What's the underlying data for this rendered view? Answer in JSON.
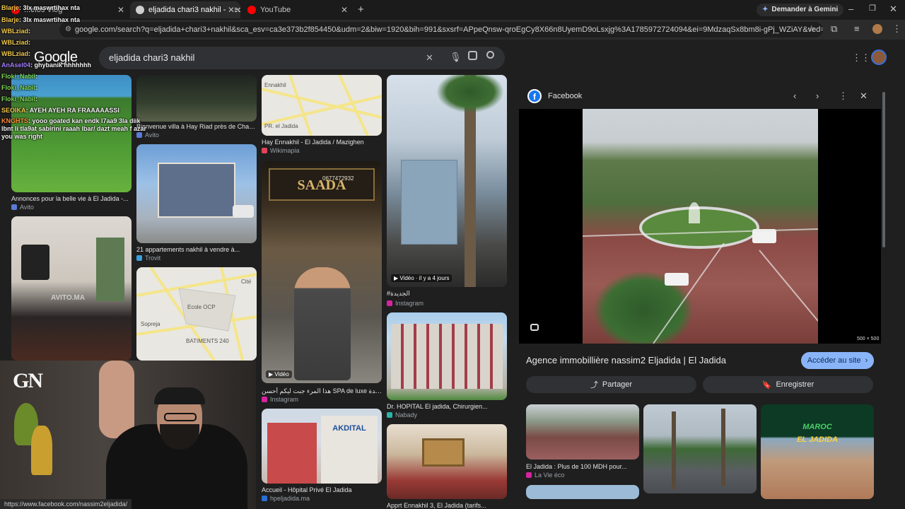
{
  "browser": {
    "tabs": [
      {
        "label": "...elos Vlog",
        "favicon_color": "#ff0000"
      },
      {
        "label": "eljadida chari3 nakhil - Recherc",
        "favicon_color": "#cfcfcf"
      },
      {
        "label": "YouTube",
        "favicon_color": "#ff0000"
      }
    ],
    "gemini_label": "Demander à Gemini",
    "url": "google.com/search?q=eljadida+chari3+nakhil&sca_esv=ca3e373b2f854450&udm=2&biw=1920&bih=991&sxsrf=APpeQnsw-qroEgCy8X66n8UyemD9oLsxjg%3A1785972724094&ei=9MdzaqSx8bm8i-gPj_WZiAY&ved=0ahUKEwik-7Du0oqWAxU53g..."
  },
  "google": {
    "logo": "Google",
    "search_value": "eljadida chari3 nakhil"
  },
  "grid": {
    "col1": [
      {
        "caption": "Annonces pour la belle vie à El Jadida -...",
        "source": "Avito",
        "src_color": "#5a7bd8"
      },
      {
        "caption": "",
        "source": "",
        "watermark": "AVITO.MA"
      }
    ],
    "col2": [
      {
        "caption": "Bienvenue villa à Hay Riad près de Chari3...",
        "source": "Avito",
        "src_color": "#5a7bd8"
      },
      {
        "caption": "21 appartements nakhil à vendre à...",
        "source": "Trovit",
        "src_color": "#3aa0e0"
      },
      {
        "caption": "",
        "source": "",
        "map_labels": [
          "Cité",
          "Ecole OCP",
          "Sopreja",
          "BATIMENTS 240"
        ]
      }
    ],
    "col3": [
      {
        "caption": "Hay Ennakhil - El Jadida / Mazighen",
        "source": "Wikimapia",
        "src_color": "#e0445a",
        "map_labels": [
          "Ennakhil",
          "PR. el Jadida"
        ]
      },
      {
        "caption": "هذا المرء جبت ليكم أحسن SPA de luxe في مدينة الجديدة ...",
        "source": "Instagram",
        "src_color": "#d6249f",
        "badge": "Vidéo",
        "sign": "SAADA",
        "phone": "0677472932"
      },
      {
        "caption": "Accueil - Hôpital Privé El Jadida",
        "source": "hpeljadida.ma",
        "src_color": "#2a6fd6",
        "sign": "AKDITAL"
      }
    ],
    "col4": [
      {
        "caption": "#الجديدة",
        "source": "Instagram",
        "src_color": "#d6249f",
        "badge": "Vidéo · il y a 4 jours"
      },
      {
        "caption": "Dr. HOPITAL El jadida, Chirurgien...",
        "source": "Nabady",
        "src_color": "#2ab3a6"
      },
      {
        "caption": "Apprt Ennakhil 3, El Jadida (tarifs...",
        "source": "",
        "src_color": "#888"
      }
    ]
  },
  "panel": {
    "source_name": "Facebook",
    "dimensions": "500 × 500",
    "title": "Agence immobillière nassim2 Eljadida | El Jadida",
    "visit_button": "Accéder au site",
    "share_button": "Partager",
    "save_button": "Enregistrer",
    "related": [
      {
        "caption": "El Jadida : Plus de 100 MDH pour...",
        "source": "La Vie éco",
        "src_color": "#d6249f"
      },
      {
        "caption": "",
        "source": ""
      },
      {
        "caption": "",
        "source": "",
        "overlay_line1": "MAROC",
        "overlay_line2": "EL JADIDA"
      }
    ]
  },
  "chat": [
    {
      "name": "Blarje",
      "msg": "3lx maswrtihax nta",
      "color": "#f2c94c"
    },
    {
      "name": "Blarje",
      "msg": "3lx maswrtihax nta",
      "color": "#f2c94c"
    },
    {
      "name": "WBLziad",
      "msg": "",
      "color": "#f2c94c"
    },
    {
      "name": "WBLziad",
      "msg": "",
      "color": "#f2c94c"
    },
    {
      "name": "WBLziad",
      "msg": "",
      "color": "#f2c94c"
    },
    {
      "name": "AnAsel04",
      "msg": "ghybanik hhhhhhh",
      "color": "#a47cff"
    },
    {
      "name": "Floki_Nabil",
      "msg": "",
      "color": "#7ed957"
    },
    {
      "name": "Floki_Nabil",
      "msg": "",
      "color": "#7ed957"
    },
    {
      "name": "Floki_Nabil",
      "msg": "",
      "color": "#7ed957"
    },
    {
      "name": "SEOIKA",
      "msg": "AYEH AYEH RA FRAAAAASSI",
      "color": "#f2c94c"
    },
    {
      "name": "KNGHTS",
      "msg": "yooo goated kan endk l7aa9 3la diik lbnt li tla9at sabirini raaah lbar/ dazt meah f azar you was right",
      "color": "#ff8c3a"
    }
  ],
  "cam": {
    "logo": "GN"
  },
  "status_url": "https://www.facebook.com/nassim2eljadida/"
}
